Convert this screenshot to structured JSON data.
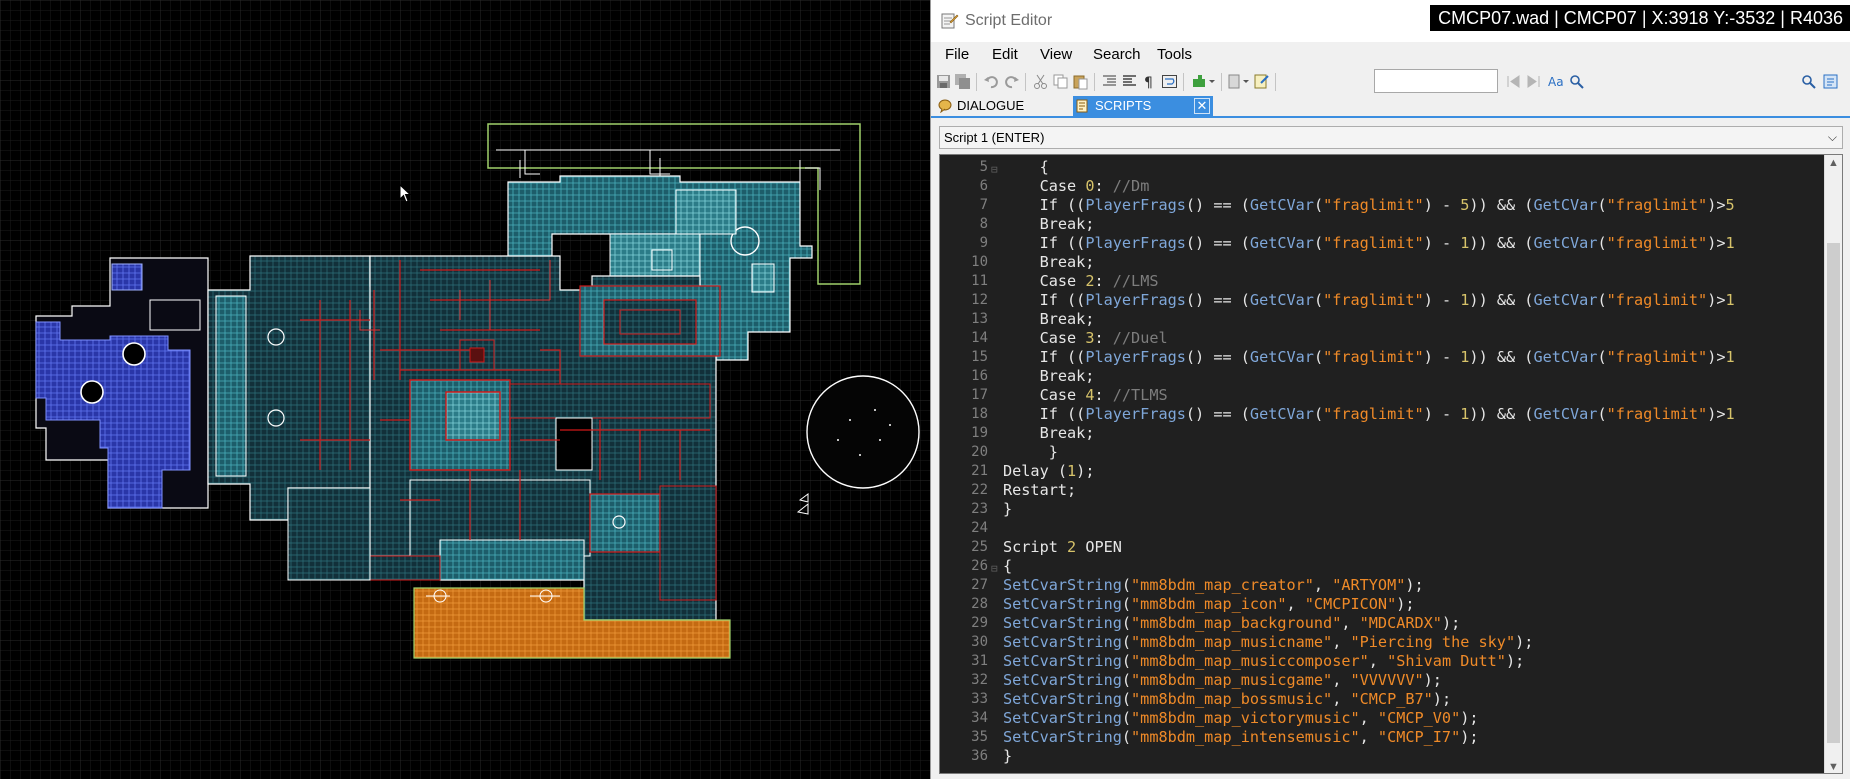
{
  "window": {
    "title": "Script Editor",
    "map_status": "CMCP07.wad | CMCP07 | X:3918 Y:-3532 | R4036"
  },
  "menu": [
    "File",
    "Edit",
    "View",
    "Search",
    "Tools"
  ],
  "toolbar": {
    "find_value": "",
    "icons": [
      "save-icon",
      "save-all-icon",
      "undo-icon",
      "redo-icon",
      "cut-icon",
      "copy-icon",
      "paste-icon",
      "indent-icon",
      "outdent-icon",
      "whitespace-icon",
      "wordwrap-icon",
      "plugin-icon",
      "compile-icon",
      "script-icon",
      "find-prev-icon",
      "find-next-icon",
      "match-case-icon",
      "replace-icon",
      "search-icon",
      "options-icon"
    ]
  },
  "tabs": [
    {
      "label": "DIALOGUE",
      "active": false
    },
    {
      "label": "SCRIPTS",
      "active": true
    }
  ],
  "script_select": "Script 1 (ENTER)",
  "code": [
    {
      "n": "5",
      "fold": "⊟",
      "t": "    {"
    },
    {
      "n": "6",
      "fold": "",
      "t": "    Case 0: //Dm"
    },
    {
      "n": "7",
      "fold": "",
      "t": "    If ((PlayerFrags() == (GetCVar(\"fraglimit\") - 5)) && (GetCVar(\"fraglimit\")>5"
    },
    {
      "n": "8",
      "fold": "",
      "t": "    Break;"
    },
    {
      "n": "9",
      "fold": "",
      "t": "    If ((PlayerFrags() == (GetCVar(\"fraglimit\") - 1)) && (GetCVar(\"fraglimit\")>1"
    },
    {
      "n": "10",
      "fold": "",
      "t": "    Break;"
    },
    {
      "n": "11",
      "fold": "",
      "t": "    Case 2: //LMS"
    },
    {
      "n": "12",
      "fold": "",
      "t": "    If ((PlayerFrags() == (GetCVar(\"fraglimit\") - 1)) && (GetCVar(\"fraglimit\")>1"
    },
    {
      "n": "13",
      "fold": "",
      "t": "    Break;"
    },
    {
      "n": "14",
      "fold": "",
      "t": "    Case 3: //Duel"
    },
    {
      "n": "15",
      "fold": "",
      "t": "    If ((PlayerFrags() == (GetCVar(\"fraglimit\") - 1)) && (GetCVar(\"fraglimit\")>1"
    },
    {
      "n": "16",
      "fold": "",
      "t": "    Break;"
    },
    {
      "n": "17",
      "fold": "",
      "t": "    Case 4: //TLMS"
    },
    {
      "n": "18",
      "fold": "",
      "t": "    If ((PlayerFrags() == (GetCVar(\"fraglimit\") - 1)) && (GetCVar(\"fraglimit\")>1"
    },
    {
      "n": "19",
      "fold": "",
      "t": "    Break;"
    },
    {
      "n": "20",
      "fold": "",
      "t": "     }"
    },
    {
      "n": "21",
      "fold": "",
      "t": "Delay (1);"
    },
    {
      "n": "22",
      "fold": "",
      "t": "Restart;"
    },
    {
      "n": "23",
      "fold": "",
      "t": "}"
    },
    {
      "n": "24",
      "fold": "",
      "t": ""
    },
    {
      "n": "25",
      "fold": "",
      "t": "Script 2 OPEN"
    },
    {
      "n": "26",
      "fold": "⊟",
      "t": "{"
    },
    {
      "n": "27",
      "fold": "",
      "t": "SetCvarString(\"mm8bdm_map_creator\", \"ARTYOM\");"
    },
    {
      "n": "28",
      "fold": "",
      "t": "SetCvarString(\"mm8bdm_map_icon\", \"CMCPICON\");"
    },
    {
      "n": "29",
      "fold": "",
      "t": "SetCvarString(\"mm8bdm_map_background\", \"MDCARDX\");"
    },
    {
      "n": "30",
      "fold": "",
      "t": "SetCvarString(\"mm8bdm_map_musicname\", \"Piercing the sky\");"
    },
    {
      "n": "31",
      "fold": "",
      "t": "SetCvarString(\"mm8bdm_map_musiccomposer\", \"Shivam Dutt\");"
    },
    {
      "n": "32",
      "fold": "",
      "t": "SetCvarString(\"mm8bdm_map_musicgame\", \"VVVVVV\");"
    },
    {
      "n": "33",
      "fold": "",
      "t": "SetCvarString(\"mm8bdm_map_bossmusic\", \"CMCP_B7\");"
    },
    {
      "n": "34",
      "fold": "",
      "t": "SetCvarString(\"mm8bdm_map_victorymusic\", \"CMCP_V0\");"
    },
    {
      "n": "35",
      "fold": "",
      "t": "SetCvarString(\"mm8bdm_map_intensemusic\", \"CMCP_I7\");"
    },
    {
      "n": "36",
      "fold": "",
      "t": "}"
    }
  ],
  "colors": {
    "editor_bg": "#202020",
    "tab_active": "#3b8ee0",
    "string": "#ef8a28",
    "function": "#7fa7d9",
    "comment": "#7d7d7d",
    "number": "#d7c36a",
    "map_grid": "#1c1c1c",
    "map_lines_white": "#ffffff",
    "map_lines_red": "#d01818",
    "map_sector_cyan": "#3aa6b0",
    "map_sector_blue": "#3a4fd0",
    "map_sector_orange": "#d97a1a",
    "map_sector_green_outline": "#9fd06a"
  }
}
